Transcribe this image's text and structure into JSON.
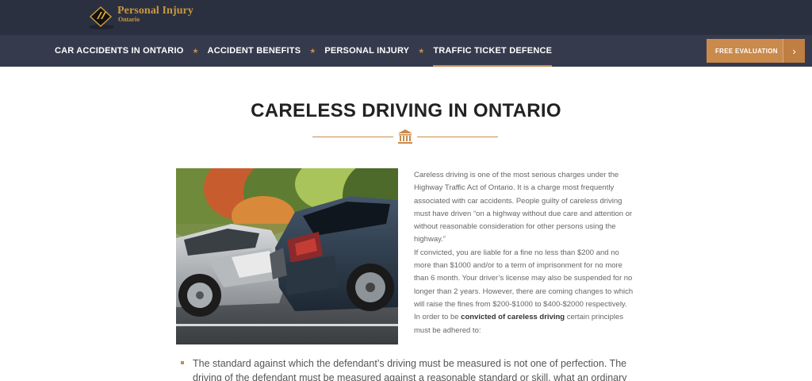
{
  "header": {
    "logo": {
      "title": "Personal Injury",
      "subtitle": "Ontario"
    }
  },
  "nav": {
    "items": [
      {
        "label": "CAR ACCIDENTS IN ONTARIO"
      },
      {
        "label": "ACCIDENT BENEFITS"
      },
      {
        "label": "PERSONAL INJURY"
      },
      {
        "label": "TRAFFIC TICKET DEFENCE"
      }
    ],
    "separator": "★",
    "active": "TRAFFIC TICKET DEFENCE",
    "cta_label": "FREE EVALUATION",
    "cta_arrow": "›"
  },
  "main": {
    "title": "CARELESS DRIVING IN ONTARIO",
    "photo_subject": "two-car collision",
    "paragraph_1": "Careless driving is one of the most serious charges under the Highway Traffic Act of Ontario. It is a charge most frequently associated with car accidents. People guilty of careless driving must have driven “on a highway without due care and attention or without reasonable consideration for other persons using the highway.”",
    "paragraph_2": "If convicted, you are liable for a fine no less than $200 and no more than $1000 and/or to a term of imprisonment for no more than 6 month. Your driver’s license may also be suspended for no longer than 2 years. However, there are coming changes to which will raise the fines from $200-$1000 to $400-$2000 respectively.",
    "paragraph_3_before": "In order to be ",
    "paragraph_3_bold": "convicted of careless driving",
    "paragraph_3_after": " certain principles must be adhered to:",
    "bullets": [
      "The standard against which the defendant’s driving must be measured is not one of perfection. The driving of the defendant must be measured against a reasonable standard or skill, what an ordinary"
    ]
  },
  "colors": {
    "topbar": "#2b3040",
    "navbar": "#353b4d",
    "accent": "#c98a4b",
    "logo_gold": "#c9983e"
  },
  "icons": {
    "divider": "bank-columns-icon",
    "logo": "road-sign-icon",
    "cta": "chevron-right-icon"
  }
}
